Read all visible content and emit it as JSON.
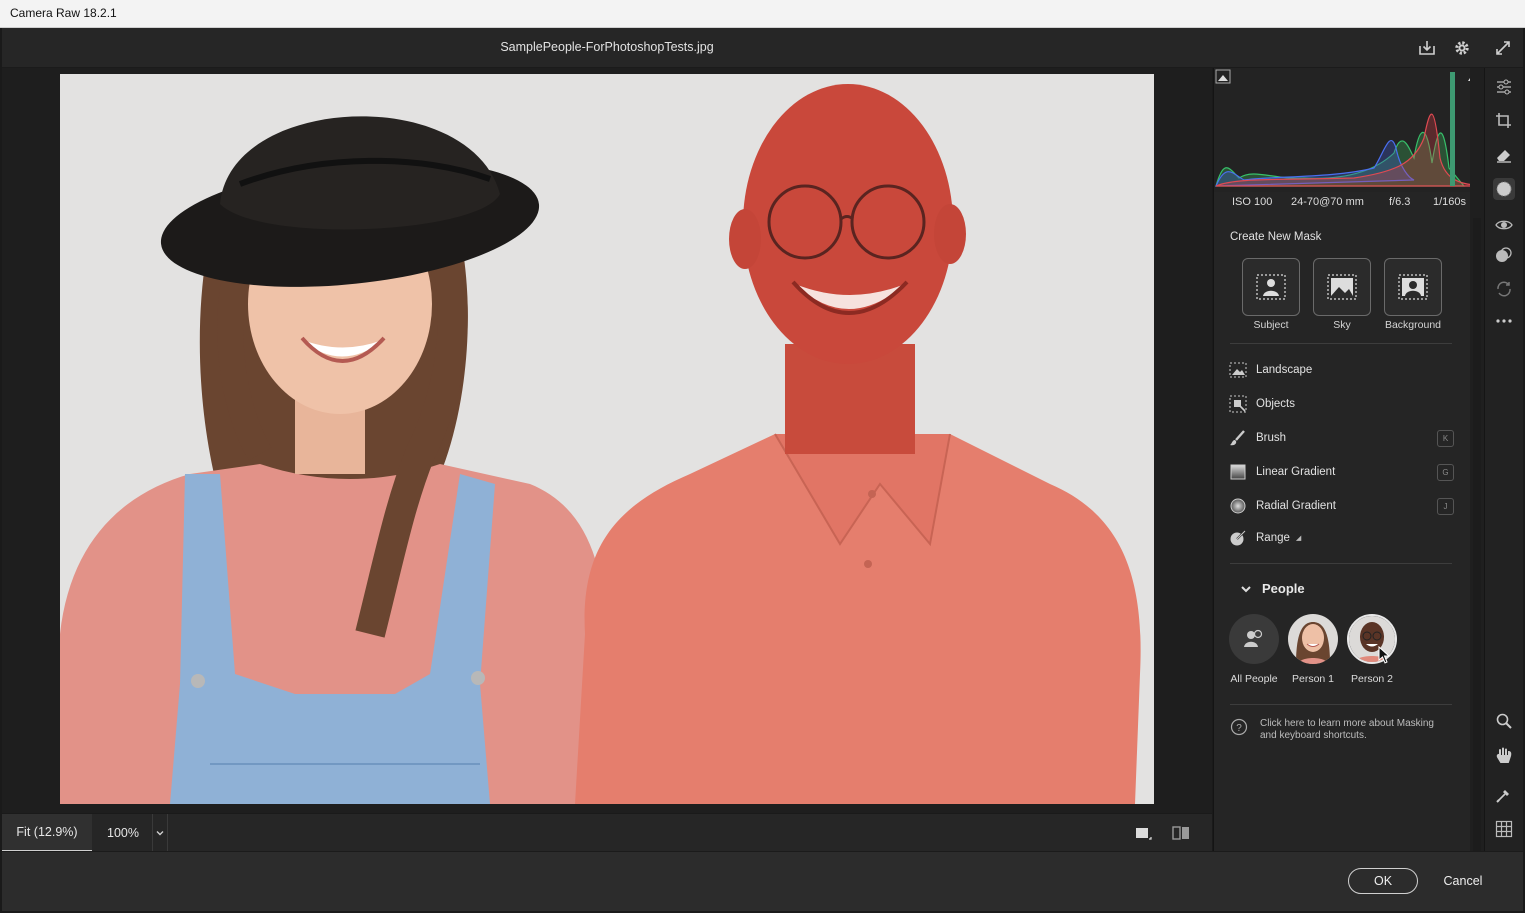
{
  "window": {
    "title": "Camera Raw 18.2.1"
  },
  "header": {
    "file_name": "SamplePeople-ForPhotoshopTests.jpg"
  },
  "zoom": {
    "fit_label": "Fit (12.9%)",
    "level_label": "100%"
  },
  "histogram": {
    "exif": {
      "iso": "ISO 100",
      "lens": "24-70@70 mm",
      "aperture": "f/6.3",
      "shutter": "1/160s"
    }
  },
  "mask_panel": {
    "create_label": "Create New Mask",
    "quick_masks": [
      {
        "label": "Subject",
        "icon": "subject-icon"
      },
      {
        "label": "Sky",
        "icon": "sky-icon"
      },
      {
        "label": "Background",
        "icon": "background-icon"
      }
    ],
    "tools": [
      {
        "label": "Landscape",
        "icon": "landscape-icon",
        "shortcut": ""
      },
      {
        "label": "Objects",
        "icon": "objects-icon",
        "shortcut": ""
      },
      {
        "label": "Brush",
        "icon": "brush-icon",
        "shortcut": "K"
      },
      {
        "label": "Linear Gradient",
        "icon": "linear-gradient-icon",
        "shortcut": "G"
      },
      {
        "label": "Radial Gradient",
        "icon": "radial-gradient-icon",
        "shortcut": "J"
      },
      {
        "label": "Range",
        "icon": "range-icon",
        "shortcut": ""
      }
    ],
    "people": {
      "heading": "People",
      "items": [
        {
          "label": "All People"
        },
        {
          "label": "Person 1"
        },
        {
          "label": "Person 2"
        }
      ]
    },
    "help_text": "Click here to learn more about Masking and keyboard shortcuts."
  },
  "footer": {
    "ok_label": "OK",
    "cancel_label": "Cancel"
  },
  "colors": {
    "mask_overlay": "#d9463c",
    "panel_bg": "#252525",
    "accent_light": "#e0e0e0"
  }
}
